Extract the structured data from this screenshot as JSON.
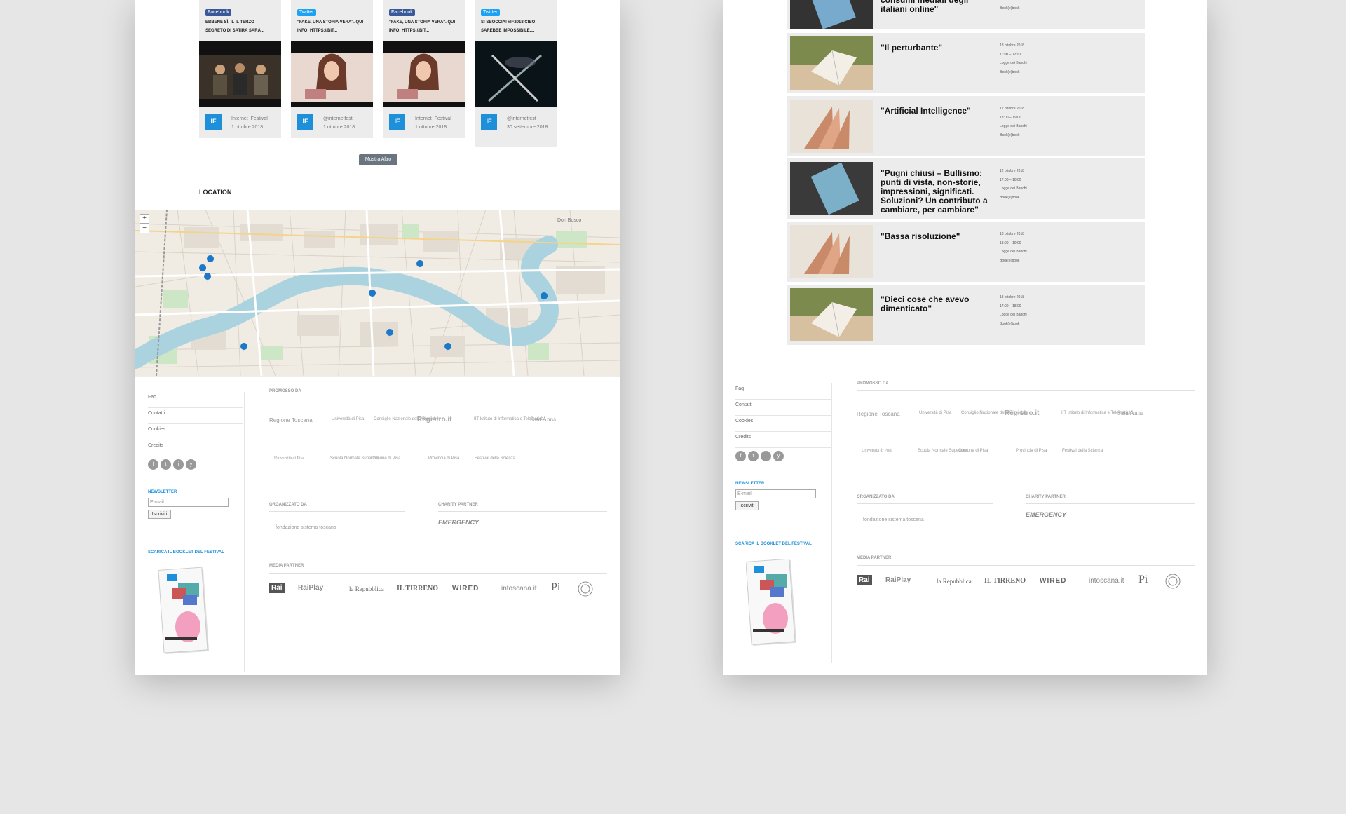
{
  "left_page": {
    "social_cards": [
      {
        "network": "Facebook",
        "title": "EBBENE SÌ, IL IL TERZO SEGRETO DI SATIRA SARÀ...",
        "user": "Internet_Festival",
        "date": "1 ottobre 2018"
      },
      {
        "network": "Twitter",
        "title": "\"FAKE, UNA STORIA VERA\". QUI INFO: HTTPS://BIT...",
        "user": "@internetfest",
        "date": "1 ottobre 2018"
      },
      {
        "network": "Facebook",
        "title": "\"FAKE, UNA STORIA VERA\". QUI INFO: HTTPS://BIT...",
        "user": "Internet_Festival",
        "date": "1 ottobre 2018"
      },
      {
        "network": "Twitter",
        "title": "SI SBOCCIA! #IF2018 CIBO SAREBBE IMPOSSIBILE....",
        "user": "@internetfest",
        "date": "30 settembre 2018"
      }
    ],
    "card_logo": "IF",
    "show_more": "Mostra Altro",
    "location_title": "LOCATION",
    "map": {
      "zoom_in": "+",
      "zoom_out": "−",
      "label_don_bosco": "Don Bosco"
    }
  },
  "footer": {
    "links": [
      "Faq",
      "Contatti",
      "Cookies",
      "Credits"
    ],
    "social_icons": [
      "f",
      "t",
      "i",
      "y"
    ],
    "newsletter_title": "NEWSLETTER",
    "newsletter_placeholder": "E-mail",
    "newsletter_button": "Iscriviti",
    "booklet_title": "SCARICA IL BOOKLET DEL FESTIVAL",
    "promoted_title": "PROMOSSO DA",
    "promoted_logos": [
      "Regione Toscana",
      "Università di Pisa",
      "Consiglio Nazionale delle Ricerche",
      "Registro.it",
      "IIT Istituto di Informatica e Telematica",
      "Sant'Anna",
      "Università di Pisa",
      "Scuola Normale Superiore",
      "Comune di Pisa",
      "Provincia di Pisa",
      "Festival della Scienza"
    ],
    "organized_title": "ORGANIZZATO DA",
    "organizer": "fondazione sistema toscana",
    "charity_title": "CHARITY PARTNER",
    "charity": "EMERGENCY",
    "media_title": "MEDIA PARTNER",
    "media": [
      "Rai",
      "RaiPlay",
      "la Repubblica",
      "IL TIRRENO",
      "WIRED",
      "intoscana.it",
      "Pi"
    ]
  },
  "right_page": {
    "partial_event": {
      "title": "consumi mediali degli italiani online\"",
      "meta": [
        "Book(e)book"
      ]
    },
    "events": [
      {
        "title": "\"Il perturbante\"",
        "date": "13 ottobre 2018",
        "time": "11:00 – 12:00",
        "place": "Logge dei Banchi",
        "org": "Book(e)book"
      },
      {
        "title": "\"Artificial Intelligence\"",
        "date": "12 ottobre 2018",
        "time": "18:00 – 19:00",
        "place": "Logge dei Banchi",
        "org": "Book(e)book"
      },
      {
        "title": "\"Pugni chiusi – Bullismo: punti di vista, non-storie, impressioni, significati. Soluzioni? Un contributo a cambiare, per cambiare\"",
        "date": "12 ottobre 2018",
        "time": "17:00 – 18:00",
        "place": "Logge dei Banchi",
        "org": "Book(e)book"
      },
      {
        "title": "\"Bassa risoluzione\"",
        "date": "13 ottobre 2018",
        "time": "18:00 – 19:00",
        "place": "Logge dei Banchi",
        "org": "Book(e)book"
      },
      {
        "title": "\"Dieci cose che avevo dimenticato\"",
        "date": "13 ottobre 2018",
        "time": "17:00 – 18:00",
        "place": "Logge dei Banchi",
        "org": "Book(e)book"
      }
    ]
  }
}
